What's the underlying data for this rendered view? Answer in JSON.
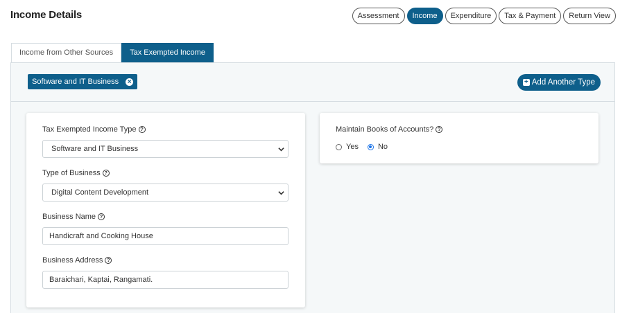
{
  "page": {
    "title": "Income Details"
  },
  "steps": [
    {
      "label": "Assessment",
      "active": false
    },
    {
      "label": "Income",
      "active": true
    },
    {
      "label": "Expenditure",
      "active": false
    },
    {
      "label": "Tax & Payment",
      "active": false
    },
    {
      "label": "Return View",
      "active": false
    }
  ],
  "tabs": [
    {
      "label": "Income from Other Sources",
      "active": false
    },
    {
      "label": "Tax Exempted Income",
      "active": true
    }
  ],
  "type_bar": {
    "chip_label": "Software and IT Business",
    "add_button_label": "Add Another Type"
  },
  "form": {
    "exempted_type": {
      "label": "Tax Exempted Income Type",
      "value": "Software and IT Business"
    },
    "business_type": {
      "label": "Type of Business",
      "value": "Digital Content Development"
    },
    "business_name": {
      "label": "Business Name",
      "value": "Handicraft and Cooking House"
    },
    "business_address": {
      "label": "Business Address",
      "value": "Baraichari, Kaptai, Rangamati."
    }
  },
  "books": {
    "label": "Maintain Books of Accounts?",
    "options": [
      {
        "label": "Yes",
        "checked": false
      },
      {
        "label": "No",
        "checked": true
      }
    ]
  },
  "colors": {
    "accent": "#0e5f8b",
    "radio_checked": "#1a73e8",
    "panel_bg": "#f5f8f9"
  },
  "icons": [
    "help-icon",
    "close-icon",
    "plus-icon",
    "chevron-down-icon"
  ]
}
